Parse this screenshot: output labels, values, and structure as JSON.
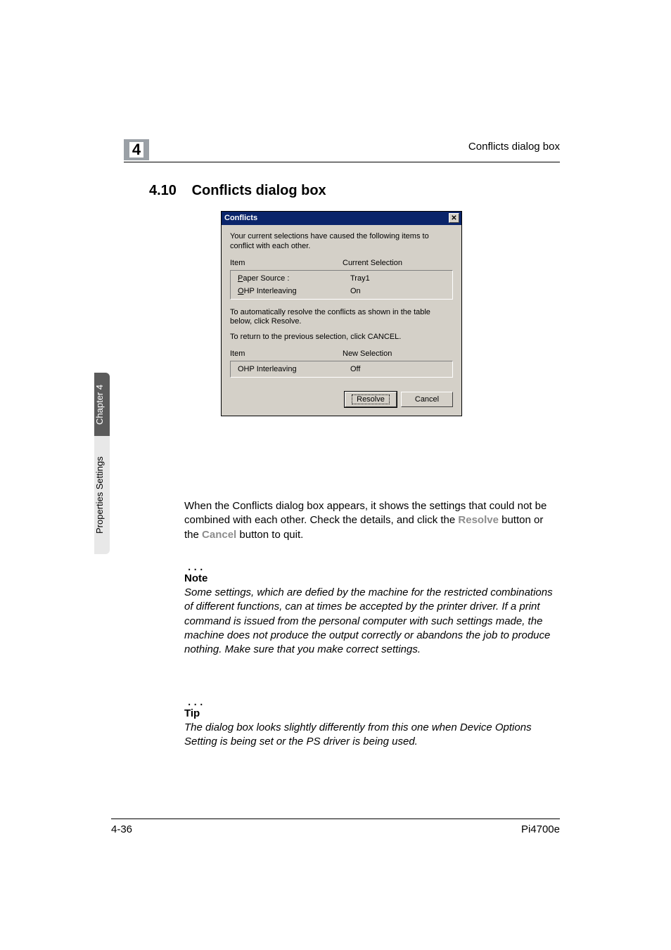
{
  "header": {
    "running_head": "Conflicts dialog box",
    "chapter_number": "4"
  },
  "section": {
    "number": "4.10",
    "title": "Conflicts dialog box"
  },
  "dialog": {
    "title": "Conflicts",
    "close_glyph": "✕",
    "intro_text": "Your current selections have caused the following items to conflict with each other.",
    "table1_header_item": "Item",
    "table1_header_value": "Current Selection",
    "table1_rows": [
      {
        "item_prefix": "P",
        "item_rest": "aper Source :",
        "value": "Tray1"
      },
      {
        "item_prefix": "O",
        "item_rest": "HP Interleaving",
        "value": "On"
      }
    ],
    "instr1": "To automatically resolve the conflicts as shown in the table below, click Resolve.",
    "instr2": "To return to the previous selection, click CANCEL.",
    "table2_header_item": "Item",
    "table2_header_value": "New Selection",
    "table2_rows": [
      {
        "item": "OHP Interleaving",
        "value": "Off"
      }
    ],
    "resolve_label": "Resolve",
    "cancel_label": "Cancel"
  },
  "body": {
    "para1_a": "When the Conflicts dialog box appears, it shows the settings that could not be combined with each other. Check the details, and click the ",
    "para1_b": "Resolve",
    "para1_c": " button or the ",
    "para1_d": "Cancel",
    "para1_e": " button to quit."
  },
  "hint1": {
    "label": "Note",
    "text": "Some settings, which are defied by the machine for the restricted combinations of different functions, can at times be accepted by the printer driver. If a print command is issued from the personal computer with such settings made, the machine does not produce the output correctly or abandons the job to produce nothing. Make sure that you make correct settings."
  },
  "hint2": {
    "label": "Tip",
    "text": "The dialog box looks slightly differently from this one when Device Options Setting is being set or the PS driver is being used."
  },
  "side_tab": {
    "dark_label": "Chapter 4",
    "light_label": "Properties Settings"
  },
  "footer": {
    "page": "4-36",
    "product": "Pi4700e"
  }
}
